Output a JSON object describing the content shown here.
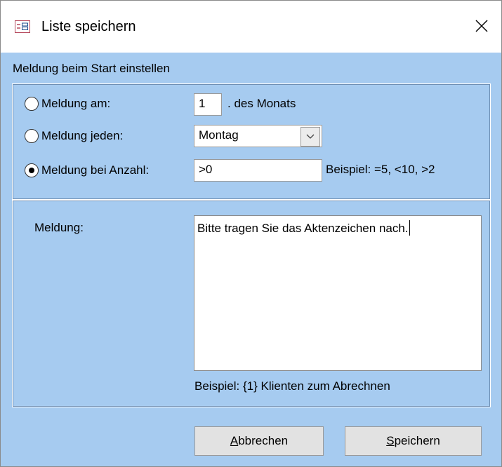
{
  "window": {
    "title": "Liste speichern",
    "icon": "form-icon",
    "close_icon": "close-icon"
  },
  "section": {
    "label": "Meldung beim Start einstellen"
  },
  "options": {
    "monthly": {
      "label": "Meldung am:",
      "selected": false,
      "day_value": "1",
      "suffix": ". des Monats"
    },
    "weekly": {
      "label": "Meldung jeden:",
      "selected": false,
      "day_value": "Montag"
    },
    "count": {
      "label": "Meldung bei Anzahl:",
      "selected": true,
      "value": ">0",
      "example": "Beispiel: =5, <10, >2"
    }
  },
  "message": {
    "label": "Meldung:",
    "value": "Bitte tragen Sie das Aktenzeichen nach.",
    "example": "Beispiel: {1} Klienten zum Abrechnen"
  },
  "buttons": {
    "cancel": {
      "accel": "A",
      "rest": "bbrechen"
    },
    "save": {
      "accel": "S",
      "rest": "peichern"
    }
  },
  "colors": {
    "dialog_background": "#a6cbf0",
    "titlebar": "#ffffff"
  }
}
